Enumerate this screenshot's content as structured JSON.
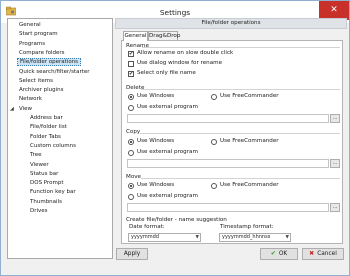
{
  "window": {
    "title": "Settings",
    "close_glyph": "✕",
    "app_icon": "folder-settings-icon"
  },
  "sidebar": {
    "expand_glyph": "◢",
    "items": [
      {
        "label": "General"
      },
      {
        "label": "Start program"
      },
      {
        "label": "Programs"
      },
      {
        "label": "Compare folders"
      },
      {
        "label": "File/folder operations",
        "selected": true
      },
      {
        "label": "Quick search/filter/starter"
      },
      {
        "label": "Select items"
      },
      {
        "label": "Archiver plugins"
      },
      {
        "label": "Network"
      },
      {
        "label": "View",
        "expanded": true
      },
      {
        "label": "Address bar"
      },
      {
        "label": "File/folder list"
      },
      {
        "label": "Folder Tabs"
      },
      {
        "label": "Custom columns"
      },
      {
        "label": "Tree"
      },
      {
        "label": "Viewer"
      },
      {
        "label": "Status bar"
      },
      {
        "label": "DOS Prompt"
      },
      {
        "label": "Function key bar"
      },
      {
        "label": "Thumbnails"
      },
      {
        "label": "Drives"
      }
    ]
  },
  "page": {
    "header": "File/folder operations",
    "tabs": [
      {
        "label": "General",
        "active": true
      },
      {
        "label": "Drag&Drop",
        "active": false
      }
    ]
  },
  "rename": {
    "title": "Rename",
    "check_glyph": "✔",
    "options": [
      {
        "label": "Allow rename on slow double click",
        "checked": true
      },
      {
        "label": "Use dialog window for rename",
        "checked": false
      },
      {
        "label": "Select only file name",
        "checked": true
      }
    ]
  },
  "delete": {
    "title": "Delete",
    "use_windows": "Use Windows",
    "use_freecommander": "Use FreeCommander",
    "use_external": "Use external program",
    "selected": "use_windows",
    "browse": "..."
  },
  "copy": {
    "title": "Copy",
    "use_windows": "Use Windows",
    "use_freecommander": "Use FreeCommander",
    "use_external": "Use external program",
    "selected": "use_windows",
    "browse": "..."
  },
  "move": {
    "title": "Move",
    "use_windows": "Use Windows",
    "use_freecommander": "Use FreeCommander",
    "use_external": "Use external program",
    "selected": "use_windows",
    "browse": "..."
  },
  "suggestion": {
    "title": "Create file/folder - name suggestion",
    "date_format_label": "Date format:",
    "date_format_value": "yyyymmdd",
    "timestamp_format_label": "Timestamp format:",
    "timestamp_format_value": "yyyymmdd_hhnnss",
    "combo_arrow": "▼"
  },
  "buttons": {
    "apply": "Apply",
    "ok": "OK",
    "ok_glyph": "✔",
    "cancel": "Cancel",
    "cancel_glyph": "✖"
  }
}
